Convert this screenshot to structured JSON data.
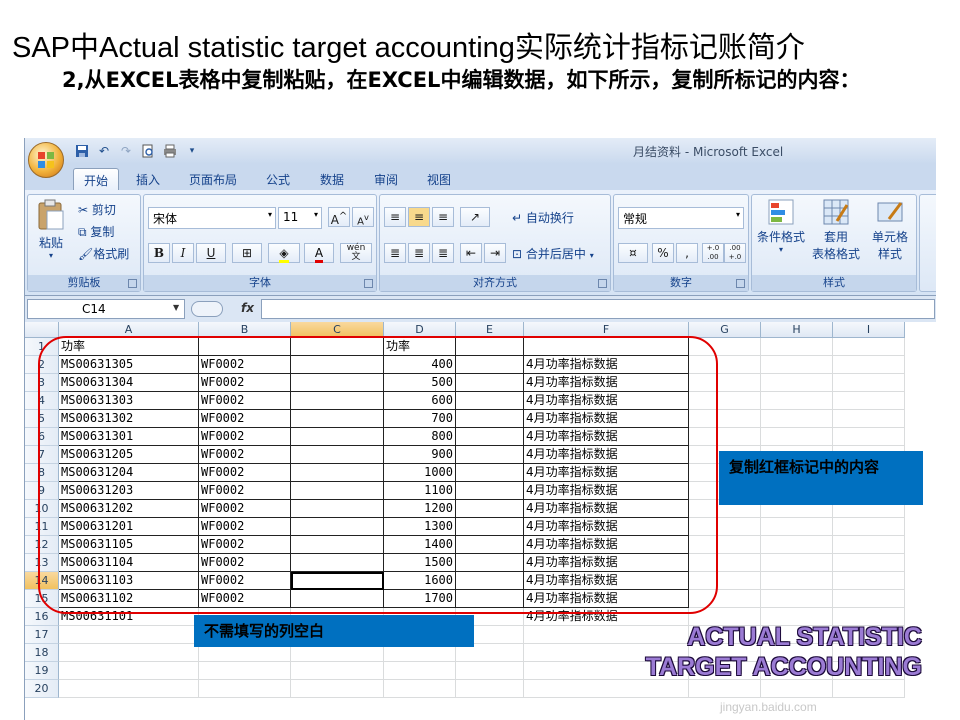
{
  "slide": {
    "title": "SAP中Actual statistic target accounting实际统计指标记账简介",
    "subtitle": "2,从EXCEL表格中复制粘贴，在EXCEL中编辑数据，如下所示，复制所标记的内容："
  },
  "window": {
    "title": "月结资料 - Microsoft Excel"
  },
  "tabs": [
    "开始",
    "插入",
    "页面布局",
    "公式",
    "数据",
    "审阅",
    "视图"
  ],
  "ribbon": {
    "clipboard": {
      "label": "剪贴板",
      "paste": "粘贴",
      "cut": "剪切",
      "copy": "复制",
      "format_painter": "格式刷"
    },
    "font": {
      "label": "字体",
      "font_name": "宋体",
      "font_size": "11",
      "bold": "B",
      "italic": "I",
      "underline": "U",
      "wen": "wén",
      "wen_char": "文"
    },
    "alignment": {
      "label": "对齐方式",
      "wrap": "自动换行",
      "merge": "合并后居中"
    },
    "number": {
      "label": "数字",
      "format": "常规",
      "percent": "%",
      "comma": ",",
      "inc_decimal": "+.0 .00",
      "dec_decimal": ".00 +.0"
    },
    "styles": {
      "label": "样式",
      "conditional": "条件格式",
      "table_format_1": "套用",
      "table_format_2": "表格格式",
      "cell_style_1": "单元格",
      "cell_style_2": "样式"
    }
  },
  "formula_bar": {
    "name_box": "C14",
    "fx": "fx",
    "content": ""
  },
  "columns": [
    "A",
    "B",
    "C",
    "D",
    "E",
    "F",
    "G",
    "H",
    "I"
  ],
  "rows": [
    "1",
    "2",
    "3",
    "4",
    "5",
    "6",
    "7",
    "8",
    "9",
    "10",
    "11",
    "12",
    "13",
    "14",
    "15",
    "16",
    "17",
    "18",
    "19",
    "20"
  ],
  "header_row": {
    "a": "功率",
    "d": "功率"
  },
  "data_rows": [
    {
      "a": "MS00631305",
      "b": "WF0002",
      "d": "400",
      "f": "4月功率指标数据"
    },
    {
      "a": "MS00631304",
      "b": "WF0002",
      "d": "500",
      "f": "4月功率指标数据"
    },
    {
      "a": "MS00631303",
      "b": "WF0002",
      "d": "600",
      "f": "4月功率指标数据"
    },
    {
      "a": "MS00631302",
      "b": "WF0002",
      "d": "700",
      "f": "4月功率指标数据"
    },
    {
      "a": "MS00631301",
      "b": "WF0002",
      "d": "800",
      "f": "4月功率指标数据"
    },
    {
      "a": "MS00631205",
      "b": "WF0002",
      "d": "900",
      "f": "4月功率指标数据"
    },
    {
      "a": "MS00631204",
      "b": "WF0002",
      "d": "1000",
      "f": "4月功率指标数据"
    },
    {
      "a": "MS00631203",
      "b": "WF0002",
      "d": "1100",
      "f": "4月功率指标数据"
    },
    {
      "a": "MS00631202",
      "b": "WF0002",
      "d": "1200",
      "f": "4月功率指标数据"
    },
    {
      "a": "MS00631201",
      "b": "WF0002",
      "d": "1300",
      "f": "4月功率指标数据"
    },
    {
      "a": "MS00631105",
      "b": "WF0002",
      "d": "1400",
      "f": "4月功率指标数据"
    },
    {
      "a": "MS00631104",
      "b": "WF0002",
      "d": "1500",
      "f": "4月功率指标数据"
    },
    {
      "a": "MS00631103",
      "b": "WF0002",
      "d": "1600",
      "f": "4月功率指标数据"
    },
    {
      "a": "MS00631102",
      "b": "WF0002",
      "d": "1700",
      "f": "4月功率指标数据"
    },
    {
      "a": "MS00631101",
      "b": "",
      "d": "",
      "f": "4月功率指标数据"
    }
  ],
  "annotations": {
    "copy_note": "复制红框标记中的内容",
    "blank_note": "不需填写的列空白",
    "wordart_line1": "ACTUAL STATISTIC",
    "wordart_line2": "TARGET ACCOUNTING",
    "watermark": "jingyan.baidu.com"
  },
  "colors": {
    "frame": "#e00000",
    "note_fill": "#0070c0",
    "selected_header": "#f1c15f"
  }
}
